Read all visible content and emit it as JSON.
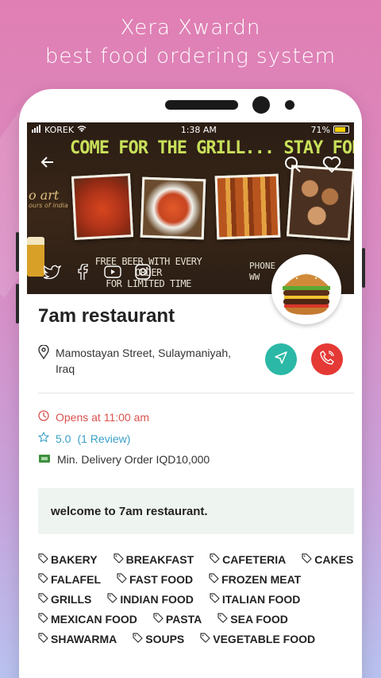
{
  "promo": {
    "line1": "Xera Xwardn",
    "line2": "best food ordering system"
  },
  "status_bar": {
    "carrier": "KOREK",
    "time": "1:38 AM",
    "battery": "71%"
  },
  "banner": {
    "headline": "COME FOR THE GRILL... STAY FOR THE",
    "logo_text": "o art",
    "logo_sub": "ours of india",
    "promo_line1": "FREE BEER WITH EVERY ORDER",
    "promo_line2": "FOR LIMITED TIME",
    "phone_label1": "PHONE",
    "phone_label2": "WW"
  },
  "restaurant": {
    "name": "7am restaurant",
    "address": "Mamostayan Street, Sulaymaniyah, Iraq",
    "opens": "Opens at 11:00 am",
    "rating": "5.0",
    "reviews": "(1 Review)",
    "min_delivery": "Min. Delivery Order IQD10,000",
    "welcome": "welcome to 7am restaurant."
  },
  "tags": [
    "BAKERY",
    "BREAKFAST",
    "CAFETERIA",
    "CAKES",
    "FALAFEL",
    "FAST FOOD",
    "FROZEN MEAT",
    "GRILLS",
    "INDIAN FOOD",
    "ITALIAN FOOD",
    "MEXICAN FOOD",
    "PASTA",
    "SEA FOOD",
    "SHAWARMA",
    "SOUPS",
    "VEGETABLE FOOD"
  ],
  "colors": {
    "nav_button": "#2bb8a6",
    "call_button": "#e53935",
    "opens_text": "#d9534f",
    "rating_text": "#3aa0c8"
  },
  "icons": [
    "back-arrow-icon",
    "search-icon",
    "heart-icon",
    "twitter-icon",
    "facebook-icon",
    "youtube-icon",
    "instagram-icon",
    "location-pin-icon",
    "navigate-icon",
    "phone-icon",
    "clock-icon",
    "star-icon",
    "delivery-icon",
    "tag-icon"
  ]
}
